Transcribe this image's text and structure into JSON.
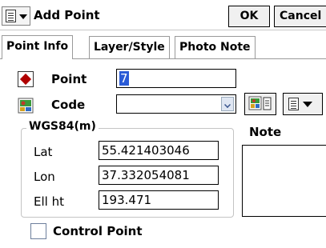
{
  "window": {
    "title": "Add Point",
    "ok_label": "OK",
    "cancel_label": "Cancel"
  },
  "tabs": [
    {
      "label": "Point Info",
      "active": true
    },
    {
      "label": "Layer/Style",
      "active": false
    },
    {
      "label": "Photo Note",
      "active": false
    }
  ],
  "point": {
    "label": "Point",
    "value": "7"
  },
  "code": {
    "label": "Code",
    "value": ""
  },
  "coords": {
    "group_title": "WGS84(m)",
    "lat_label": "Lat",
    "lat_value": "55.421403046",
    "lon_label": "Lon",
    "lon_value": "37.332054081",
    "ell_label": "Ell ht",
    "ell_value": "193.471"
  },
  "note": {
    "label": "Note",
    "value": ""
  },
  "control_point": {
    "label": "Control Point",
    "checked": false
  },
  "icons": {
    "menu": "menu-sheet-dropdown-icon",
    "point": "point-diamond-icon",
    "code": "code-map-icon",
    "code_list": "code-list-icon"
  },
  "colors": {
    "selection": "#2a5bd7",
    "point_marker": "#b00000"
  }
}
